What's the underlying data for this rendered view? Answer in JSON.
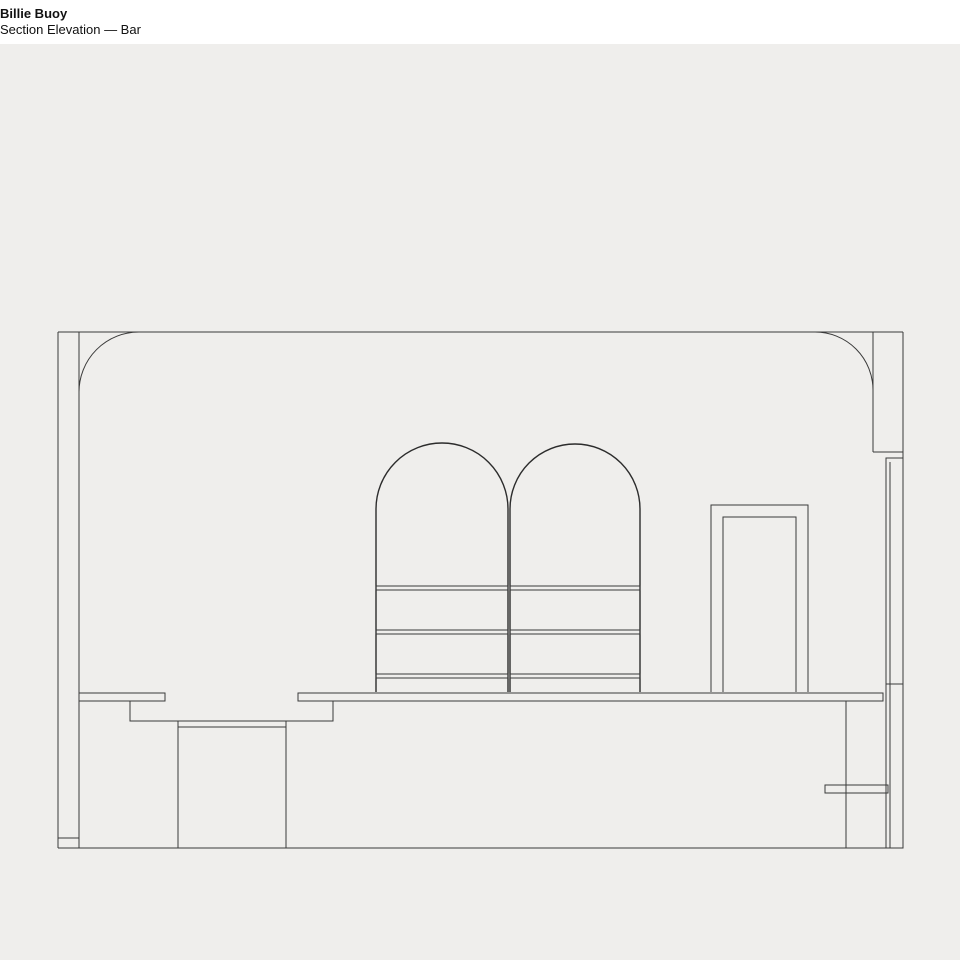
{
  "header": {
    "project_name": "Billie Buoy",
    "drawing_title": "Section Elevation — Bar"
  },
  "colors": {
    "background": "#efeeec",
    "header_background": "#ffffff",
    "line": "#3a3a3a",
    "text": "#111111"
  }
}
